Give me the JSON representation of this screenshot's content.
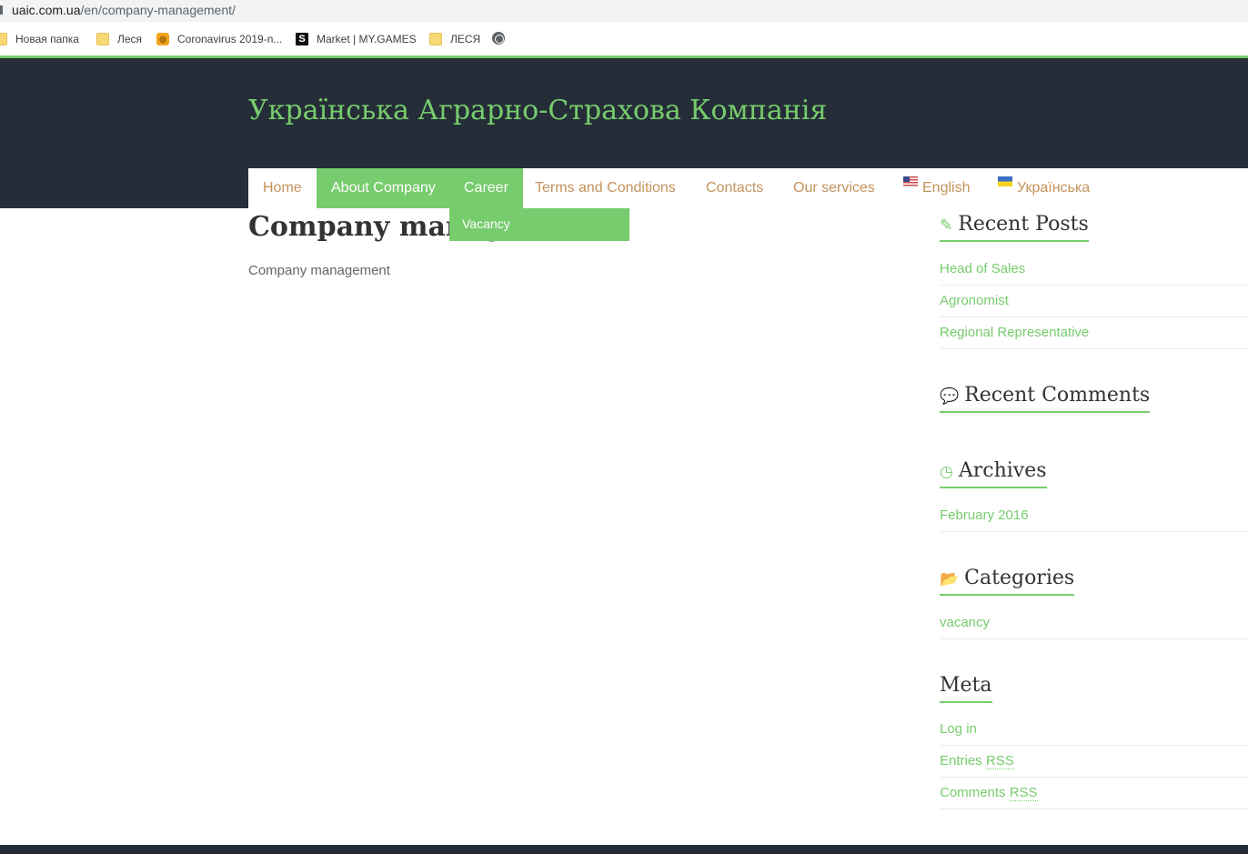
{
  "browser": {
    "url_host": "uaic.com.ua",
    "url_path": "/en/company-management/",
    "bookmarks": [
      {
        "label": "Новая папка",
        "icon": "folder-icon"
      },
      {
        "label": "Леся",
        "icon": "folder-icon"
      },
      {
        "label": "Coronavirus 2019-n...",
        "icon": "coronavirus-site-icon"
      },
      {
        "label": "Market | MY.GAMES",
        "icon": "mygames-s-icon"
      },
      {
        "label": "ЛЕСЯ",
        "icon": "folder-icon"
      }
    ]
  },
  "site": {
    "title": "Українська Аграрно-Страхова Компанія",
    "accent_color": "#77cc6d",
    "header_color": "#252e38",
    "link_color": "#c4935c"
  },
  "nav": {
    "items": [
      {
        "label": "Home",
        "active": false
      },
      {
        "label": "About Company",
        "active": true
      },
      {
        "label": "Career",
        "active": true
      },
      {
        "label": "Terms and Conditions",
        "active": false
      },
      {
        "label": "Contacts",
        "active": false
      },
      {
        "label": "Our services",
        "active": false
      },
      {
        "label": "English",
        "flag": "us-flag-icon"
      },
      {
        "label": "Українська",
        "flag": "ua-flag-icon"
      }
    ],
    "dropdown": {
      "label": "Vacancy"
    }
  },
  "main": {
    "title": "Company management",
    "body": "Company management"
  },
  "sidebar": {
    "recent_posts": {
      "title": "Recent Posts",
      "icon": "pencil-icon",
      "items": [
        "Head of Sales",
        "Agronomist",
        "Regional Representative"
      ]
    },
    "recent_comments": {
      "title": "Recent Comments",
      "icon": "comments-icon"
    },
    "archives": {
      "title": "Archives",
      "icon": "clock-icon",
      "items": [
        "February 2016"
      ]
    },
    "categories": {
      "title": "Categories",
      "icon": "folder-open-icon",
      "items": [
        "vacancy"
      ]
    },
    "meta": {
      "title": "Meta",
      "items": [
        "Log in",
        "Entries",
        "Comments"
      ],
      "rss": "RSS"
    }
  }
}
